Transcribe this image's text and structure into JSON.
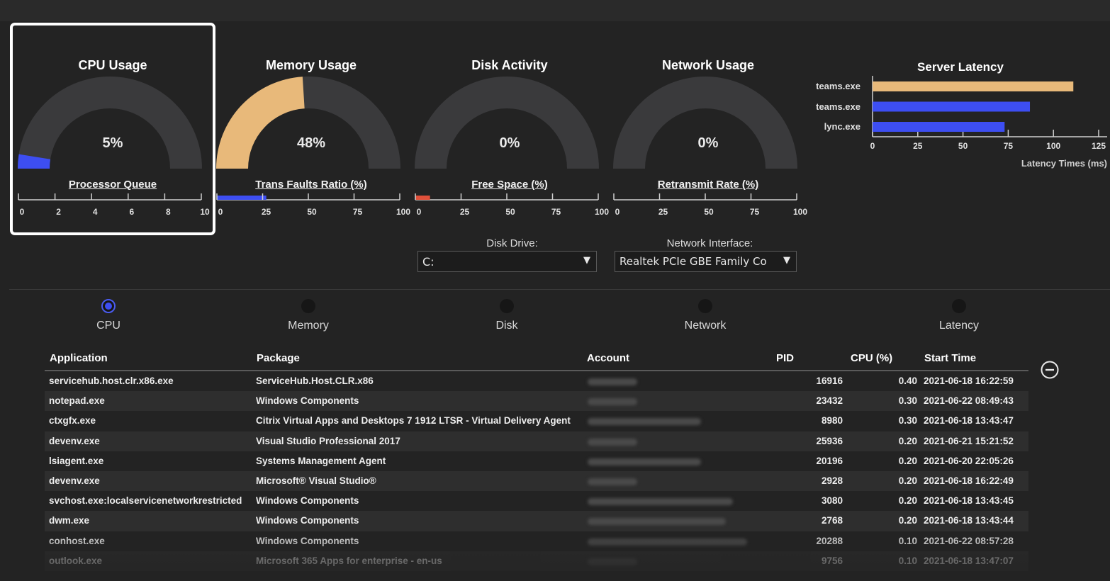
{
  "gauges": [
    {
      "title": "CPU Usage",
      "value_text": "5%",
      "value": 5,
      "sub_title": "Processor Queue",
      "scale": [
        "0",
        "2",
        "4",
        "6",
        "8",
        "10"
      ],
      "scale_fill": 0,
      "selected": true,
      "color": "#3d4ef2"
    },
    {
      "title": "Memory Usage",
      "value_text": "48%",
      "value": 48,
      "sub_title": "Trans Faults Ratio (%)",
      "scale": [
        "0",
        "25",
        "50",
        "75",
        "100"
      ],
      "scale_fill": 27,
      "selected": false,
      "color": "#e8b97a"
    },
    {
      "title": "Disk Activity",
      "value_text": "0%",
      "value": 0,
      "sub_title": "Free Space (%)",
      "scale": [
        "0",
        "25",
        "50",
        "75",
        "100"
      ],
      "scale_fill": 8,
      "scale_fill_color": "#e0503a",
      "selected": false,
      "color": "#3d4ef2"
    },
    {
      "title": "Network Usage",
      "value_text": "0%",
      "value": 0,
      "sub_title": "Retransmit Rate (%)",
      "scale": [
        "0",
        "25",
        "50",
        "75",
        "100"
      ],
      "scale_fill": 0,
      "selected": false,
      "color": "#3d4ef2"
    }
  ],
  "latency": {
    "title": "Server Latency",
    "xlabel": "Latency Times (ms)",
    "ticks": [
      "0",
      "25",
      "50",
      "75",
      "100",
      "125"
    ],
    "xmax": 125,
    "bars": [
      {
        "label": "teams.exe",
        "value": 111,
        "color": "#e8b97a"
      },
      {
        "label": "teams.exe",
        "value": 87,
        "color": "#3d4ef2"
      },
      {
        "label": "lync.exe",
        "value": 73,
        "color": "#3d4ef2"
      }
    ]
  },
  "selectors": {
    "disk_label": "Disk Drive:",
    "disk_value": "C:",
    "net_label": "Network Interface:",
    "net_value": "Realtek PCIe GBE Family Co"
  },
  "tabs": [
    {
      "label": "CPU",
      "active": true
    },
    {
      "label": "Memory",
      "active": false
    },
    {
      "label": "Disk",
      "active": false
    },
    {
      "label": "Network",
      "active": false
    },
    {
      "label": "Latency",
      "active": false
    }
  ],
  "table": {
    "headers": {
      "application": "Application",
      "package": "Package",
      "account": "Account",
      "pid": "PID",
      "cpu": "CPU (%)",
      "start": "Start Time"
    },
    "rows": [
      {
        "application": "servicehub.host.clr.x86.exe",
        "package": "ServiceHub.Host.CLR.x86",
        "pid": "16916",
        "cpu": "0.40",
        "start": "2021-06-18 16:22:59",
        "acct_w": 70
      },
      {
        "application": "notepad.exe",
        "package": "Windows Components",
        "pid": "23432",
        "cpu": "0.30",
        "start": "2021-06-22 08:49:43",
        "acct_w": 70
      },
      {
        "application": "ctxgfx.exe",
        "package": "Citrix Virtual Apps and Desktops 7 1912 LTSR - Virtual Delivery Agent",
        "pid": "8980",
        "cpu": "0.30",
        "start": "2021-06-18 13:43:47",
        "acct_w": 160
      },
      {
        "application": "devenv.exe",
        "package": "Visual Studio Professional 2017",
        "pid": "25936",
        "cpu": "0.20",
        "start": "2021-06-21 15:21:52",
        "acct_w": 70
      },
      {
        "application": "lsiagent.exe",
        "package": "Systems Management Agent",
        "pid": "20196",
        "cpu": "0.20",
        "start": "2021-06-20 22:05:26",
        "acct_w": 160
      },
      {
        "application": "devenv.exe",
        "package": "Microsoft® Visual Studio®",
        "pid": "2928",
        "cpu": "0.20",
        "start": "2021-06-18 16:22:49",
        "acct_w": 70
      },
      {
        "application": "svchost.exe:localservicenetworkrestricted",
        "package": "Windows Components",
        "pid": "3080",
        "cpu": "0.20",
        "start": "2021-06-18 13:43:45",
        "acct_w": 205
      },
      {
        "application": "dwm.exe",
        "package": "Windows Components",
        "pid": "2768",
        "cpu": "0.20",
        "start": "2021-06-18 13:43:44",
        "acct_w": 195
      },
      {
        "application": "conhost.exe",
        "package": "Windows Components",
        "pid": "20288",
        "cpu": "0.10",
        "start": "2021-06-22 08:57:28",
        "acct_w": 225
      },
      {
        "application": "outlook.exe",
        "package": "Microsoft 365 Apps for enterprise - en-us",
        "pid": "9756",
        "cpu": "0.10",
        "start": "2021-06-18 13:47:07",
        "acct_w": 70
      }
    ]
  }
}
